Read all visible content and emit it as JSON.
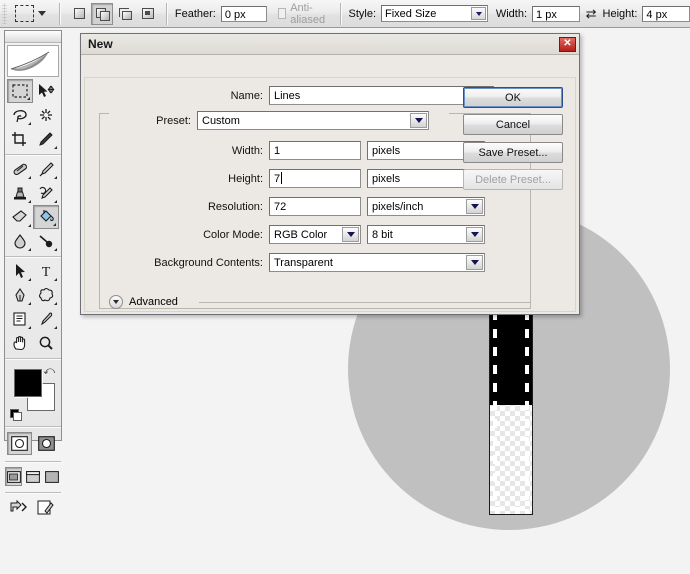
{
  "options_bar": {
    "tool_preset_icon": "rectangular-marquee-icon",
    "selection_modes": [
      {
        "name": "new-selection",
        "active": false
      },
      {
        "name": "add-to-selection",
        "active": true
      },
      {
        "name": "subtract-from-selection",
        "active": false
      },
      {
        "name": "intersect-with-selection",
        "active": false
      }
    ],
    "feather_label": "Feather:",
    "feather_value": "0 px",
    "antialiased_label": "Anti-aliased",
    "antialiased_checked": false,
    "style_label": "Style:",
    "style_value": "Fixed Size",
    "width_label": "Width:",
    "width_value": "1 px",
    "swap_icon": "⇄",
    "height_label": "Height:",
    "height_value": "4 px"
  },
  "toolbox": {
    "logo": "feather-logo",
    "groups": [
      {
        "rows": [
          [
            {
              "icon": "rectangular-marquee-icon",
              "selected": true,
              "has_flyout": false
            },
            {
              "icon": "move-tool-icon",
              "selected": false,
              "has_flyout": false
            }
          ],
          [
            {
              "icon": "lasso-tool-icon",
              "selected": false,
              "has_flyout": true
            },
            {
              "icon": "magic-wand-icon",
              "selected": false,
              "has_flyout": false
            }
          ],
          [
            {
              "icon": "crop-tool-icon",
              "selected": false,
              "has_flyout": false
            },
            {
              "icon": "slice-tool-icon",
              "selected": false,
              "has_flyout": true
            }
          ]
        ]
      },
      {
        "rows": [
          [
            {
              "icon": "healing-brush-icon",
              "selected": false,
              "has_flyout": true
            },
            {
              "icon": "brush-tool-icon",
              "selected": false,
              "has_flyout": true
            }
          ],
          [
            {
              "icon": "clone-stamp-icon",
              "selected": false,
              "has_flyout": true
            },
            {
              "icon": "history-brush-icon",
              "selected": false,
              "has_flyout": true
            }
          ],
          [
            {
              "icon": "eraser-tool-icon",
              "selected": false,
              "has_flyout": true
            },
            {
              "icon": "paint-bucket-icon",
              "selected": true,
              "has_flyout": true
            }
          ],
          [
            {
              "icon": "blur-tool-icon",
              "selected": false,
              "has_flyout": true
            },
            {
              "icon": "dodge-tool-icon",
              "selected": false,
              "has_flyout": true
            }
          ]
        ]
      },
      {
        "rows": [
          [
            {
              "icon": "path-selection-icon",
              "selected": false,
              "has_flyout": true
            },
            {
              "icon": "type-tool-icon",
              "selected": false,
              "has_flyout": true
            }
          ],
          [
            {
              "icon": "pen-tool-icon",
              "selected": false,
              "has_flyout": true
            },
            {
              "icon": "custom-shape-icon",
              "selected": false,
              "has_flyout": true
            }
          ],
          [
            {
              "icon": "notes-tool-icon",
              "selected": false,
              "has_flyout": true
            },
            {
              "icon": "eyedropper-icon",
              "selected": false,
              "has_flyout": true
            }
          ],
          [
            {
              "icon": "hand-tool-icon",
              "selected": false,
              "has_flyout": false
            },
            {
              "icon": "zoom-tool-icon",
              "selected": false,
              "has_flyout": false
            }
          ]
        ]
      }
    ],
    "foreground_color": "#000000",
    "background_color": "#ffffff",
    "swap_colors_icon": "swap-colors-icon",
    "default_colors_icon": "default-colors-icon",
    "quick_mask": [
      {
        "name": "standard-mode-button",
        "selected": true
      },
      {
        "name": "quick-mask-mode-button",
        "selected": false
      }
    ],
    "screen_modes": [
      {
        "name": "standard-screen-mode-button",
        "selected": true
      },
      {
        "name": "full-screen-with-menubar-button",
        "selected": false
      },
      {
        "name": "full-screen-mode-button",
        "selected": false
      }
    ],
    "jump_to": [
      {
        "name": "jump-to-imageready-icon"
      },
      {
        "name": "edit-in-imageready-icon"
      }
    ]
  },
  "dialog": {
    "title": "New",
    "close_label": "✕",
    "name_label": "Name:",
    "name_value": "Lines",
    "preset_label": "Preset:",
    "preset_value": "Custom",
    "width_label": "Width:",
    "width_value": "1",
    "width_units": "pixels",
    "height_label": "Height:",
    "height_value": "7",
    "height_units": "pixels",
    "resolution_label": "Resolution:",
    "resolution_value": "72",
    "resolution_units": "pixels/inch",
    "color_mode_label": "Color Mode:",
    "color_mode_value": "RGB Color",
    "color_depth_value": "8 bit",
    "background_contents_label": "Background Contents:",
    "background_contents_value": "Transparent",
    "advanced_label": "Advanced",
    "buttons": {
      "ok": "OK",
      "cancel": "Cancel",
      "save_preset": "Save Preset...",
      "delete_preset": "Delete Preset..."
    }
  },
  "canvas_loupe": {
    "name": "magnified-canvas-preview",
    "background_color": "#c0c0c0",
    "selection_fill_color": "#000000",
    "transparent_checker": true,
    "marching_ants": true
  }
}
